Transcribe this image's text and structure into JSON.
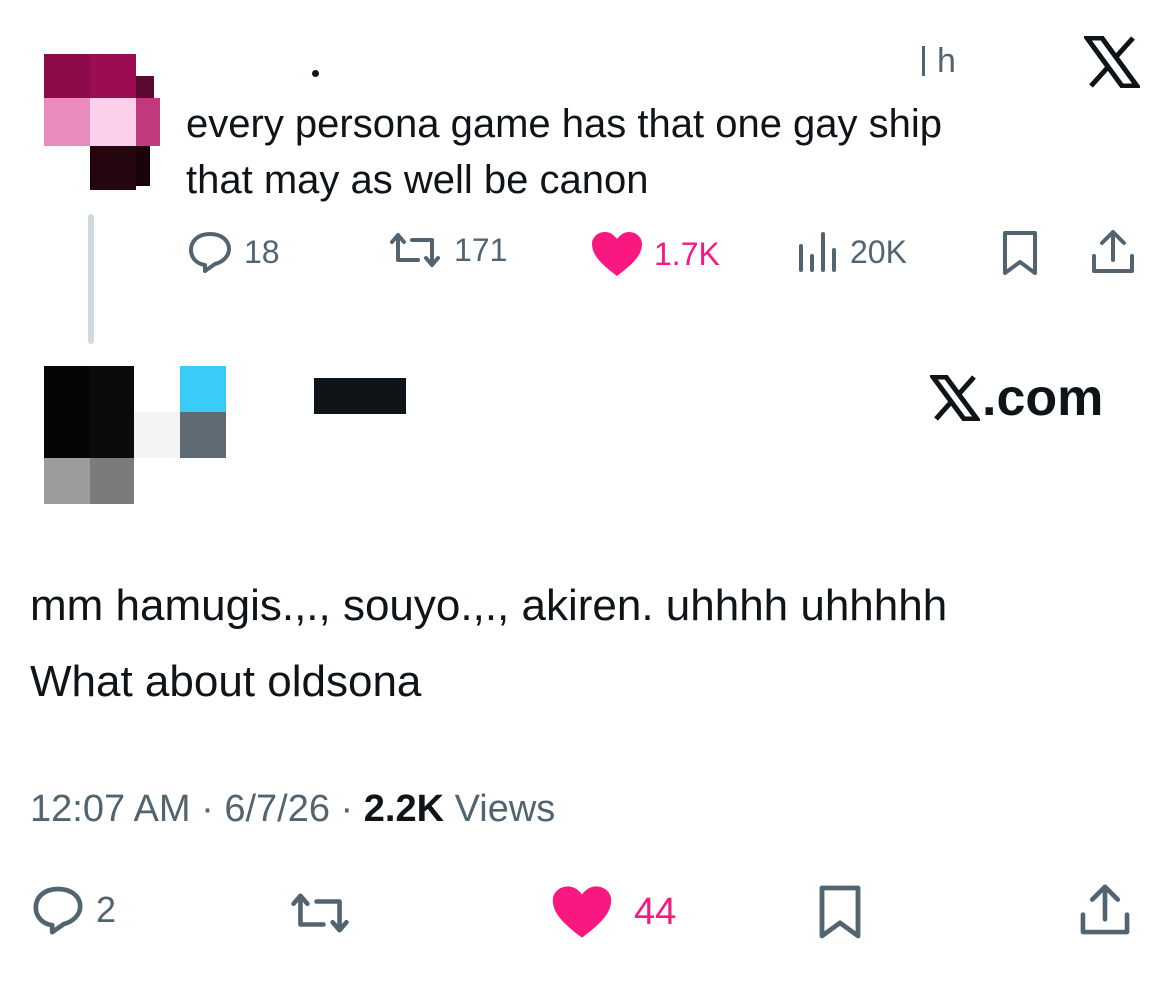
{
  "reply": {
    "time_fragment": "h",
    "text_line1": "every persona game has that one gay ship",
    "text_line2": "that may as well be canon",
    "actions": {
      "replies": "18",
      "reposts": "171",
      "likes": "1.7K",
      "views": "20K"
    }
  },
  "main": {
    "brand": ".com",
    "text_line1": "mm hamugis.,., souyo.,., akiren. uhhhh uhhhhh",
    "text_line2": "What about oldsona",
    "time": "12:07 AM",
    "sep1": " · ",
    "date": "6/7/26",
    "sep2": " · ",
    "view_count": "2.2K",
    "views_label": " Views",
    "actions": {
      "replies": "2",
      "likes": "44"
    }
  },
  "colors": {
    "like": "#f91880",
    "muted": "#536471",
    "text": "#0f1419",
    "thread_line": "#cfd9de"
  },
  "icons": [
    "x-logo-icon",
    "reply-icon",
    "repost-icon",
    "heart-icon",
    "views-icon",
    "bookmark-icon",
    "share-icon"
  ]
}
